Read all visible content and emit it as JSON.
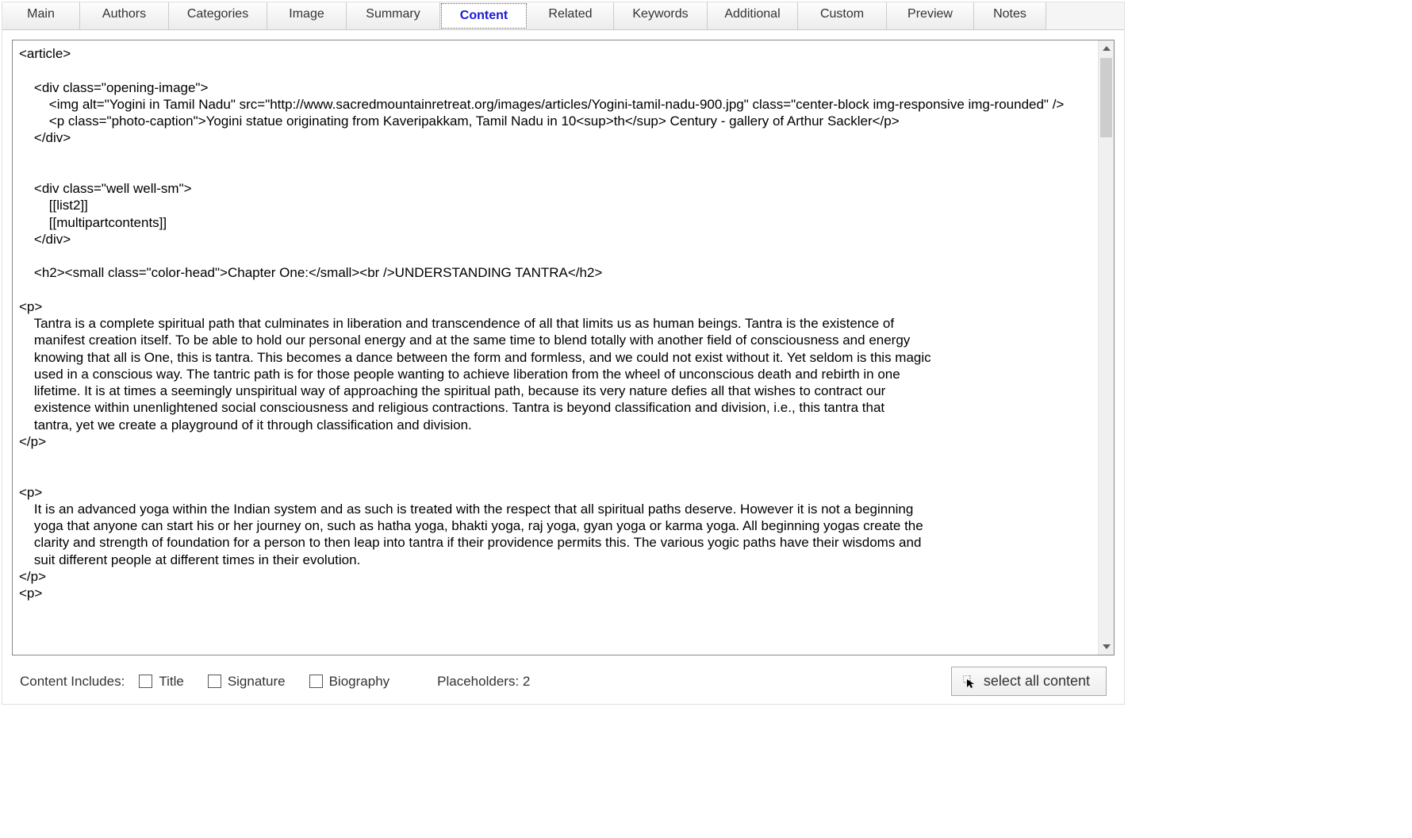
{
  "tabs": [
    {
      "label": "Main"
    },
    {
      "label": "Authors"
    },
    {
      "label": "Categories"
    },
    {
      "label": "Image"
    },
    {
      "label": "Summary"
    },
    {
      "label": "Content",
      "active": true
    },
    {
      "label": "Related"
    },
    {
      "label": "Keywords"
    },
    {
      "label": "Additional"
    },
    {
      "label": "Custom"
    },
    {
      "label": "Preview"
    },
    {
      "label": "Notes"
    }
  ],
  "editor_content": "<article>\n\n    <div class=\"opening-image\">\n        <img alt=\"Yogini in Tamil Nadu\" src=\"http://www.sacredmountainretreat.org/images/articles/Yogini-tamil-nadu-900.jpg\" class=\"center-block img-responsive img-rounded\" />\n        <p class=\"photo-caption\">Yogini statue originating from Kaveripakkam, Tamil Nadu in 10<sup>th</sup> Century - gallery of Arthur Sackler</p>\n    </div>\n\n\n    <div class=\"well well-sm\">\n        [[list2]]\n        [[multipartcontents]]\n    </div>\n\n    <h2><small class=\"color-head\">Chapter One:</small><br />UNDERSTANDING TANTRA</h2>\n\n<p>\n    Tantra is a complete spiritual path that culminates in liberation and transcendence of all that limits us as human beings. Tantra is the existence of\n    manifest creation itself. To be able to hold our personal energy and at the same time to blend totally with another field of consciousness and energy\n    knowing that all is One, this is tantra. This becomes a dance between the form and formless, and we could not exist without it. Yet seldom is this magic\n    used in a conscious way. The tantric path is for those people wanting to achieve liberation from the wheel of unconscious death and rebirth in one\n    lifetime. It is at times a seemingly unspiritual way of approaching the spiritual path, because its very nature defies all that wishes to contract our\n    existence within unenlightened social consciousness and religious contractions. Tantra is beyond classification and division, i.e., this tantra that\n    tantra, yet we create a playground of it through classification and division.\n</p>\n\n\n<p>\n    It is an advanced yoga within the Indian system and as such is treated with the respect that all spiritual paths deserve. However it is not a beginning\n    yoga that anyone can start his or her journey on, such as hatha yoga, bhakti yoga, raj yoga, gyan yoga or karma yoga. All beginning yogas create the\n    clarity and strength of foundation for a person to then leap into tantra if their providence permits this. The various yogic paths have their wisdoms and\n    suit different people at different times in their evolution.\n</p>\n<p>",
  "bottom": {
    "includes_label": "Content Includes:",
    "title_label": "Title",
    "signature_label": "Signature",
    "biography_label": "Biography",
    "placeholders_label": "Placeholders: 2",
    "select_all_label": "select all content"
  }
}
